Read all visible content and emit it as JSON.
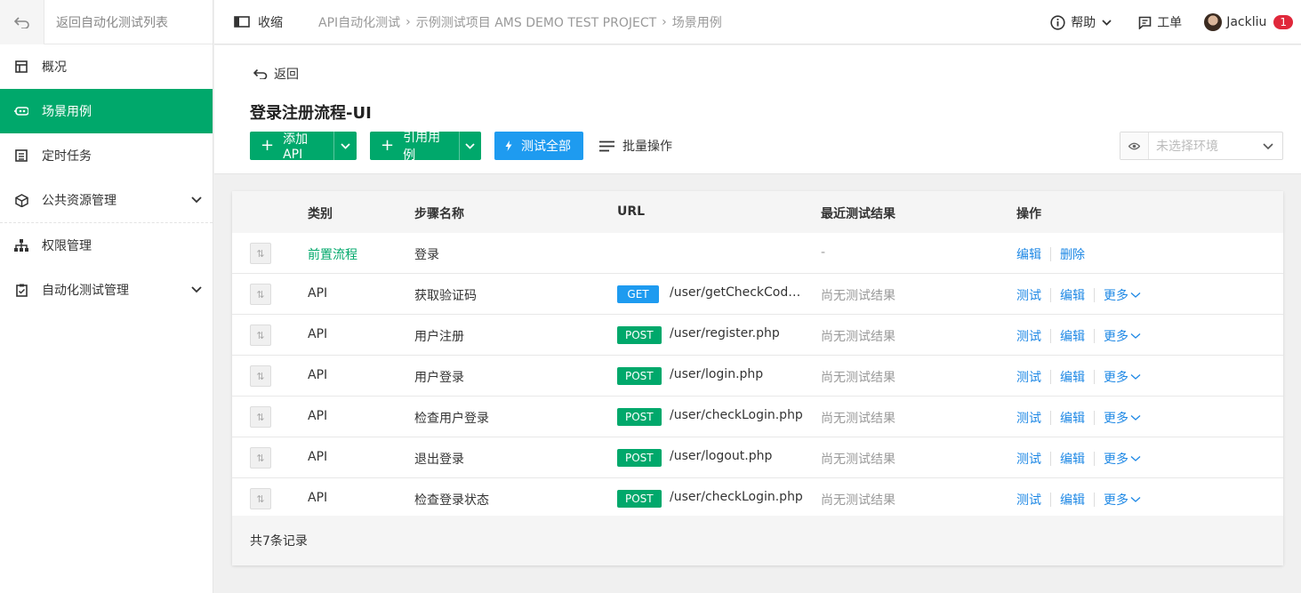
{
  "sidebar": {
    "back_label": "返回自动化测试列表",
    "items": [
      {
        "label": "概况"
      },
      {
        "label": "场景用例"
      },
      {
        "label": "定时任务"
      },
      {
        "label": "公共资源管理"
      },
      {
        "label": "权限管理"
      },
      {
        "label": "自动化测试管理"
      }
    ]
  },
  "topbar": {
    "collapse_label": "收缩",
    "breadcrumb": [
      "API自动化测试",
      "示例测试项目 AMS DEMO TEST PROJECT",
      "场景用例"
    ],
    "help_label": "帮助",
    "ticket_label": "工单",
    "user_name": "Jackliu",
    "badge_count": "1"
  },
  "header": {
    "back_label": "返回",
    "title": "登录注册流程-UI",
    "add_api_label": "添加API",
    "ref_case_label": "引用用例",
    "test_all_label": "测试全部",
    "batch_label": "批量操作",
    "env_placeholder": "未选择环境"
  },
  "table": {
    "headers": {
      "type": "类别",
      "name": "步骤名称",
      "url": "URL",
      "result": "最近测试结果",
      "ops": "操作"
    },
    "rows": [
      {
        "type": "前置流程",
        "name": "登录",
        "method": "",
        "url": "",
        "result": "-",
        "ops": [
          "编辑",
          "删除"
        ]
      },
      {
        "type": "API",
        "name": "获取验证码",
        "method": "GET",
        "url": "/user/getCheckCode.php",
        "result": "尚无测试结果",
        "ops": [
          "测试",
          "编辑",
          "更多"
        ]
      },
      {
        "type": "API",
        "name": "用户注册",
        "method": "POST",
        "url": "/user/register.php",
        "result": "尚无测试结果",
        "ops": [
          "测试",
          "编辑",
          "更多"
        ]
      },
      {
        "type": "API",
        "name": "用户登录",
        "method": "POST",
        "url": "/user/login.php",
        "result": "尚无测试结果",
        "ops": [
          "测试",
          "编辑",
          "更多"
        ]
      },
      {
        "type": "API",
        "name": "检查用户登录",
        "method": "POST",
        "url": "/user/checkLogin.php",
        "result": "尚无测试结果",
        "ops": [
          "测试",
          "编辑",
          "更多"
        ]
      },
      {
        "type": "API",
        "name": "退出登录",
        "method": "POST",
        "url": "/user/logout.php",
        "result": "尚无测试结果",
        "ops": [
          "测试",
          "编辑",
          "更多"
        ]
      },
      {
        "type": "API",
        "name": "检查登录状态",
        "method": "POST",
        "url": "/user/checkLogin.php",
        "result": "尚无测试结果",
        "ops": [
          "测试",
          "编辑",
          "更多"
        ]
      }
    ],
    "footer": "共7条记录"
  },
  "colors": {
    "accent_green": "#00a86b",
    "accent_blue": "#1e9bf0",
    "link_blue": "#1e88e5",
    "badge_red": "#e0283b"
  }
}
